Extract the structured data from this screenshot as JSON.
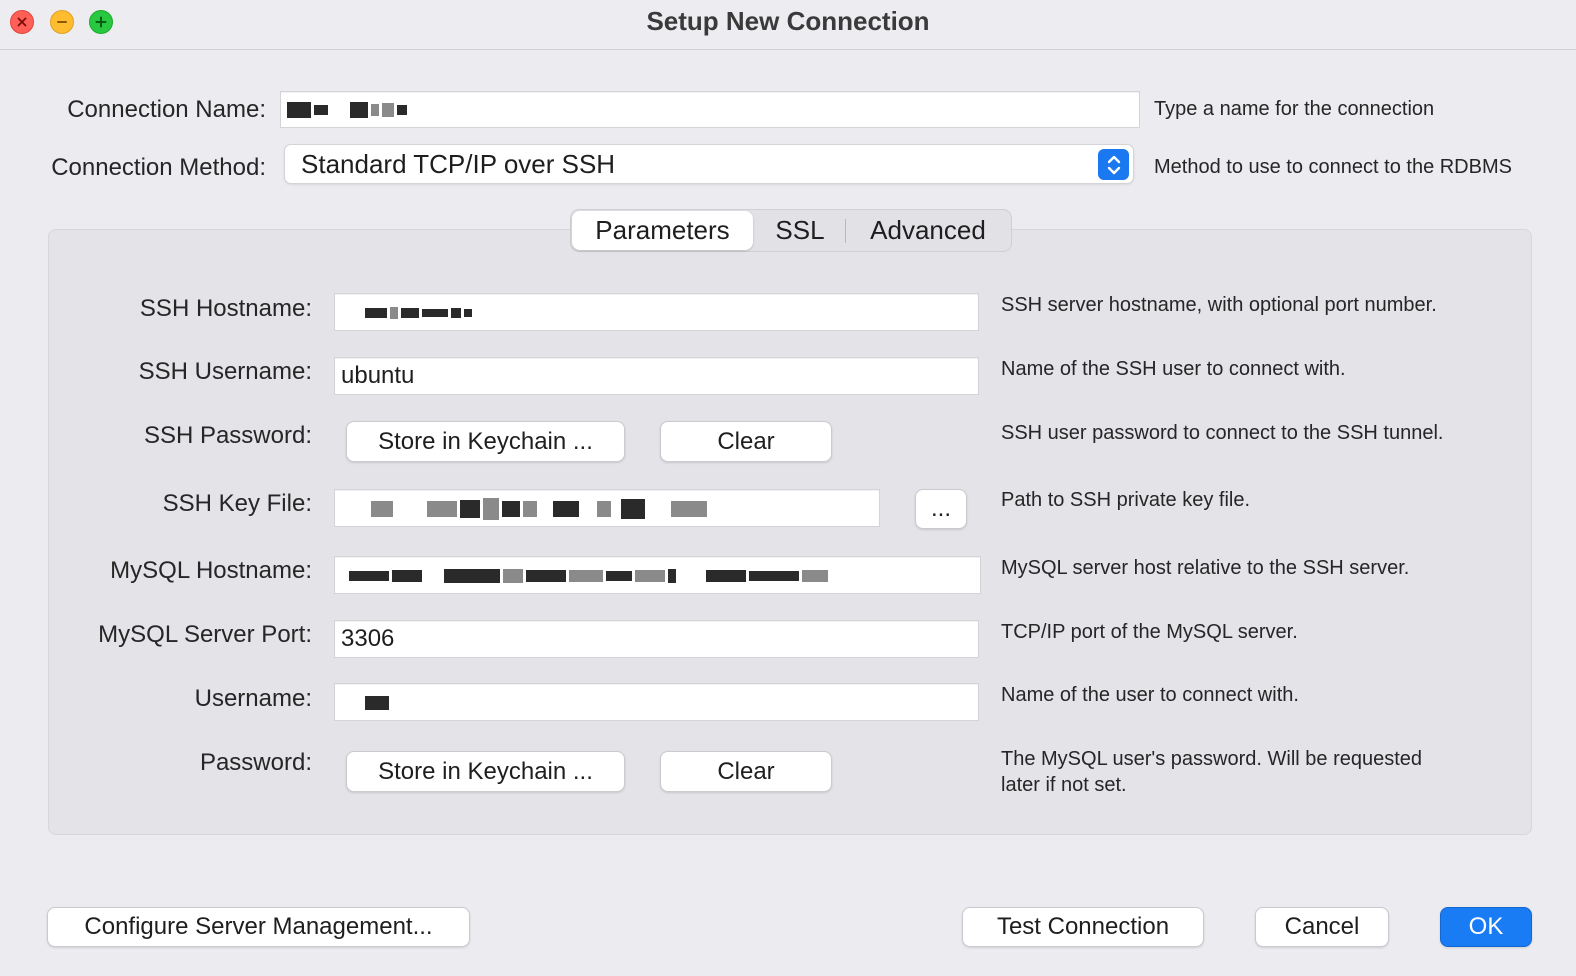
{
  "window": {
    "title": "Setup New Connection"
  },
  "connection_name": {
    "label": "Connection Name:",
    "value": "",
    "hint": "Type a name for the connection"
  },
  "connection_method": {
    "label": "Connection Method:",
    "value": "Standard TCP/IP over SSH",
    "hint": "Method to use to connect to the RDBMS"
  },
  "tabs": [
    {
      "label": "Parameters",
      "active": true
    },
    {
      "label": "SSL",
      "active": false
    },
    {
      "label": "Advanced",
      "active": false
    }
  ],
  "params": {
    "ssh_hostname": {
      "label": "SSH Hostname:",
      "value": "",
      "hint": "SSH server hostname, with  optional port number."
    },
    "ssh_username": {
      "label": "SSH Username:",
      "value": "ubuntu",
      "hint": "Name of the SSH user to connect with."
    },
    "ssh_password": {
      "label": "SSH Password:",
      "store_label": "Store in Keychain ...",
      "clear_label": "Clear",
      "hint": "SSH user password to connect to the SSH tunnel."
    },
    "ssh_key_file": {
      "label": "SSH Key File:",
      "value": "",
      "browse_label": "...",
      "hint": "Path to SSH private key file."
    },
    "mysql_hostname": {
      "label": "MySQL Hostname:",
      "value": "",
      "hint": "MySQL server host relative to the SSH server."
    },
    "mysql_port": {
      "label": "MySQL Server Port:",
      "value": "3306",
      "hint": "TCP/IP port of the MySQL server."
    },
    "username": {
      "label": "Username:",
      "value": "",
      "hint": "Name of the user to connect with."
    },
    "password": {
      "label": "Password:",
      "store_label": "Store in Keychain ...",
      "clear_label": "Clear",
      "hint_line1": "The MySQL user's password. Will be requested",
      "hint_line2": "later if not set."
    }
  },
  "footer": {
    "configure_label": "Configure Server Management...",
    "test_label": "Test Connection",
    "cancel_label": "Cancel",
    "ok_label": "OK"
  },
  "colors": {
    "accent": "#1a7cf5",
    "close": "#ff5f57",
    "minimize": "#febc2e",
    "maximize": "#28c840"
  }
}
